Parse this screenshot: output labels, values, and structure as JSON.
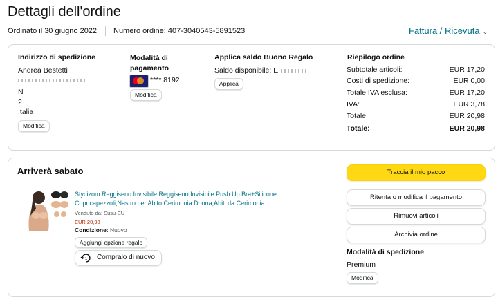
{
  "page": {
    "title": "Dettagli dell'ordine"
  },
  "meta": {
    "ordered": "Ordinato il 30 giugno 2022",
    "order_number": "Numero ordine: 407-3040543-5891523",
    "invoice": "Fattura / Ricevuta"
  },
  "shipping": {
    "heading": "Indirizzo di spedizione",
    "name": "Andrea Bestetti",
    "line2": "N",
    "line3": "2",
    "country": "Italia",
    "modify": "Modifica"
  },
  "payment": {
    "heading": "Modalità di pagamento",
    "card": "**** 8192",
    "modify": "Modifica"
  },
  "gift": {
    "heading": "Applica saldo Buono Regalo",
    "balance": "Saldo disponibile: E",
    "apply": "Applica"
  },
  "summary": {
    "heading": "Riepilogo ordine",
    "rows": [
      {
        "label": "Subtotale articoli:",
        "value": "EUR 17,20"
      },
      {
        "label": "Costi di spedizione:",
        "value": "EUR 0,00"
      },
      {
        "label": "Totale IVA esclusa:",
        "value": "EUR 17,20"
      },
      {
        "label": "IVA:",
        "value": "EUR 3,78"
      },
      {
        "label": "Totale:",
        "value": "EUR 20,98"
      },
      {
        "label": "Totale:",
        "value": "EUR 20,98"
      }
    ]
  },
  "delivery": {
    "heading": "Arriverà sabato",
    "product_title": "Stycizom Reggiseno Invisibile,Reggiseno Invisibile Push Up Bra+Silicone Copricapezzoli,Nastro per Abito Cerimonia Donna,Abiti da Cerimonia",
    "seller": "Venduto da: Susu-EU",
    "price": "EUR 20,98",
    "condition_label": "Condizione:",
    "condition_value": "Nuovo",
    "gift_option": "Aggiungi opzione regalo",
    "buy_again": "Compralo di nuovo",
    "buttons": {
      "track": "Traccia il mio pacco",
      "retry_payment": "Ritenta o modifica il pagamento",
      "remove": "Rimuovi articoli",
      "archive": "Archivia ordine"
    },
    "shipping_method_heading": "Modalità di spedizione",
    "shipping_method": "Premium",
    "modify": "Modifica"
  },
  "colors": {
    "link": "#007185",
    "button_primary": "#ffd814",
    "price": "#b12704"
  },
  "icons": {
    "card": "mastercard-icon",
    "buy_again": "reorder-icon",
    "dropdown": "chevron-down-icon"
  }
}
